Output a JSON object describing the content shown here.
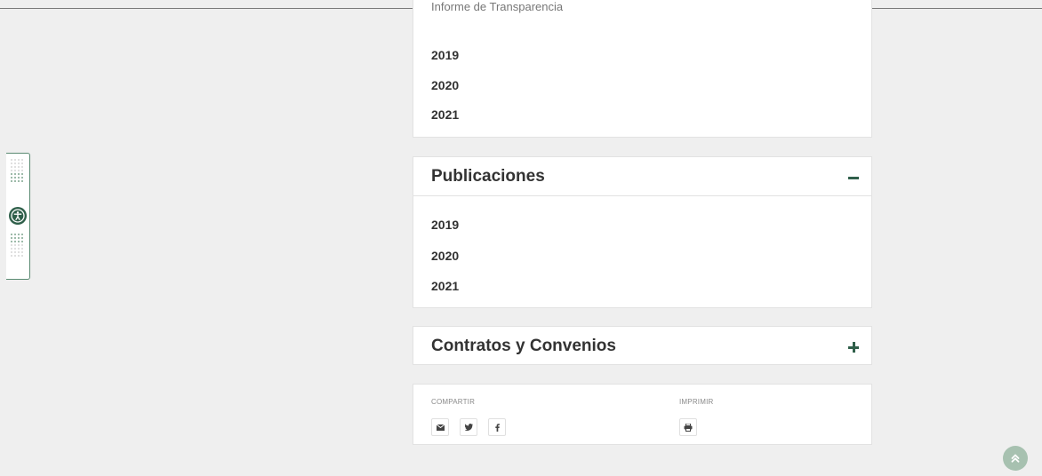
{
  "top_card": {
    "cut_text": "Informe de Transparencia",
    "years": [
      "2019",
      "2020",
      "2021"
    ]
  },
  "publicaciones": {
    "title": "Publicaciones",
    "expanded": true,
    "toggle_icon": "minus-icon",
    "years": [
      "2019",
      "2020",
      "2021"
    ]
  },
  "contratos": {
    "title": "Contratos y Convenios",
    "expanded": false,
    "toggle_icon": "plus-icon"
  },
  "share": {
    "compartir_label": "COMPARTIR",
    "imprimir_label": "IMPRIMIR",
    "share_icons": [
      "email-icon",
      "twitter-icon",
      "facebook-icon"
    ],
    "print_icon": "print-icon"
  },
  "accessibility": {
    "icon": "accessibility-icon"
  },
  "back_to_top": {
    "icon": "double-chevron-up-icon"
  },
  "colors": {
    "accent": "#2f5f4a",
    "page_bg": "#efefef",
    "card_bg": "#ffffff",
    "back_to_top_bg": "#a7c1b0"
  }
}
